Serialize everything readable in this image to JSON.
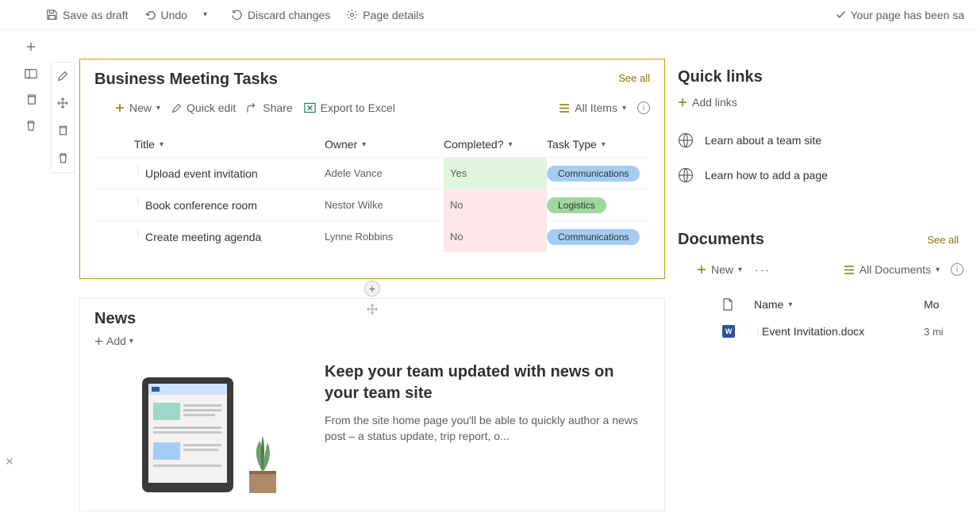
{
  "cmdbar": {
    "save_label": "Save as draft",
    "undo_label": "Undo",
    "discard_label": "Discard changes",
    "details_label": "Page details",
    "status_text": "Your page has been sa"
  },
  "tasks": {
    "title": "Business Meeting Tasks",
    "see_all": "See all",
    "toolbar": {
      "new": "New",
      "quick_edit": "Quick edit",
      "share": "Share",
      "export": "Export to Excel",
      "view": "All Items"
    },
    "columns": {
      "title": "Title",
      "owner": "Owner",
      "completed": "Completed?",
      "tasktype": "Task Type"
    },
    "rows": [
      {
        "title": "Upload event invitation",
        "owner": "Adele Vance",
        "completed": "Yes",
        "comp_class": "comp-yes",
        "tasktype": "Communications",
        "pill": "pill-comm"
      },
      {
        "title": "Book conference room",
        "owner": "Nestor Wilke",
        "completed": "No",
        "comp_class": "comp-no",
        "tasktype": "Logistics",
        "pill": "pill-log"
      },
      {
        "title": "Create meeting agenda",
        "owner": "Lynne Robbins",
        "completed": "No",
        "comp_class": "comp-no",
        "tasktype": "Communications",
        "pill": "pill-comm"
      }
    ]
  },
  "news": {
    "title": "News",
    "add_label": "Add",
    "heading": "Keep your team updated with news on your team site",
    "desc": "From the site home page you'll be able to quickly author a news post – a status update, trip report, o..."
  },
  "quicklinks": {
    "title": "Quick links",
    "add_label": "Add links",
    "links": [
      {
        "label": "Learn about a team site"
      },
      {
        "label": "Learn how to add a page"
      }
    ]
  },
  "documents": {
    "title": "Documents",
    "see_all": "See all",
    "toolbar": {
      "new": "New",
      "view": "All Documents"
    },
    "columns": {
      "name": "Name",
      "mod": "Mo"
    },
    "rows": [
      {
        "name": "Event Invitation.docx",
        "mod": "3 mi"
      }
    ]
  }
}
